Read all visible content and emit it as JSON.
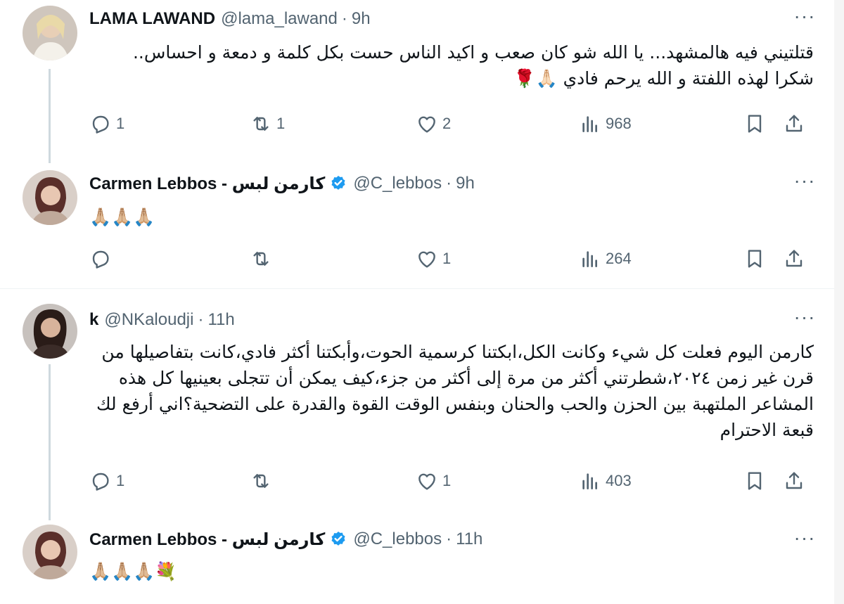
{
  "tweets": [
    {
      "name": "LAMA LAWAND",
      "handle": "@lama_lawand",
      "sep": "·",
      "time": "9h",
      "more": "···",
      "text": "قتلتيني فيه هالمشهد... يا الله شو كان صعب و اكيد الناس حست بكل كلمة و دمعة و احساس.. شكرا لهذه اللفتة و الله يرحم فادي 🙏🏻🌹",
      "replies": "1",
      "retweets": "1",
      "likes": "2",
      "views": "968"
    },
    {
      "name": "Carmen Lebbos - كارمن لبس",
      "handle": "@C_lebbos",
      "sep": "·",
      "time": "9h",
      "more": "···",
      "text": "🙏🏼🙏🏼🙏🏼",
      "replies": "",
      "retweets": "",
      "likes": "1",
      "views": "264"
    },
    {
      "name": "k",
      "handle": "@NKaloudji",
      "sep": "·",
      "time": "11h",
      "more": "···",
      "text": "كارمن اليوم فعلت كل شيء وكانت الكل،ابكتنا كرسمية الحوت،وأبكتنا أكثر فادي،كانت بتفاصيلها من قرن غير زمن ٢٠٢٤،شطرتني أكثر من مرة إلى أكثر من جزء،كيف يمكن أن تتجلى بعينيها كل هذه المشاعر الملتهبة بين الحزن والحب والحنان وبنفس الوقت القوة والقدرة على التضحية؟اني أرفع لك قبعة الاحترام",
      "replies": "1",
      "retweets": "",
      "likes": "1",
      "views": "403"
    },
    {
      "name": "Carmen Lebbos - كارمن لبس",
      "handle": "@C_lebbos",
      "sep": "·",
      "time": "11h",
      "more": "···",
      "text": "🙏🏼🙏🏼🙏🏼💐",
      "replies": "",
      "retweets": "",
      "likes": "",
      "views": ""
    }
  ],
  "colors": {
    "text": "#0f1419",
    "secondary": "#536471",
    "verified": "#1d9bf0",
    "thread_line": "#cfd9de",
    "divider": "#eff3f4"
  },
  "icons": [
    "reply-icon",
    "retweet-icon",
    "like-icon",
    "views-icon",
    "bookmark-icon",
    "share-icon",
    "verified-badge-icon",
    "more-icon"
  ]
}
